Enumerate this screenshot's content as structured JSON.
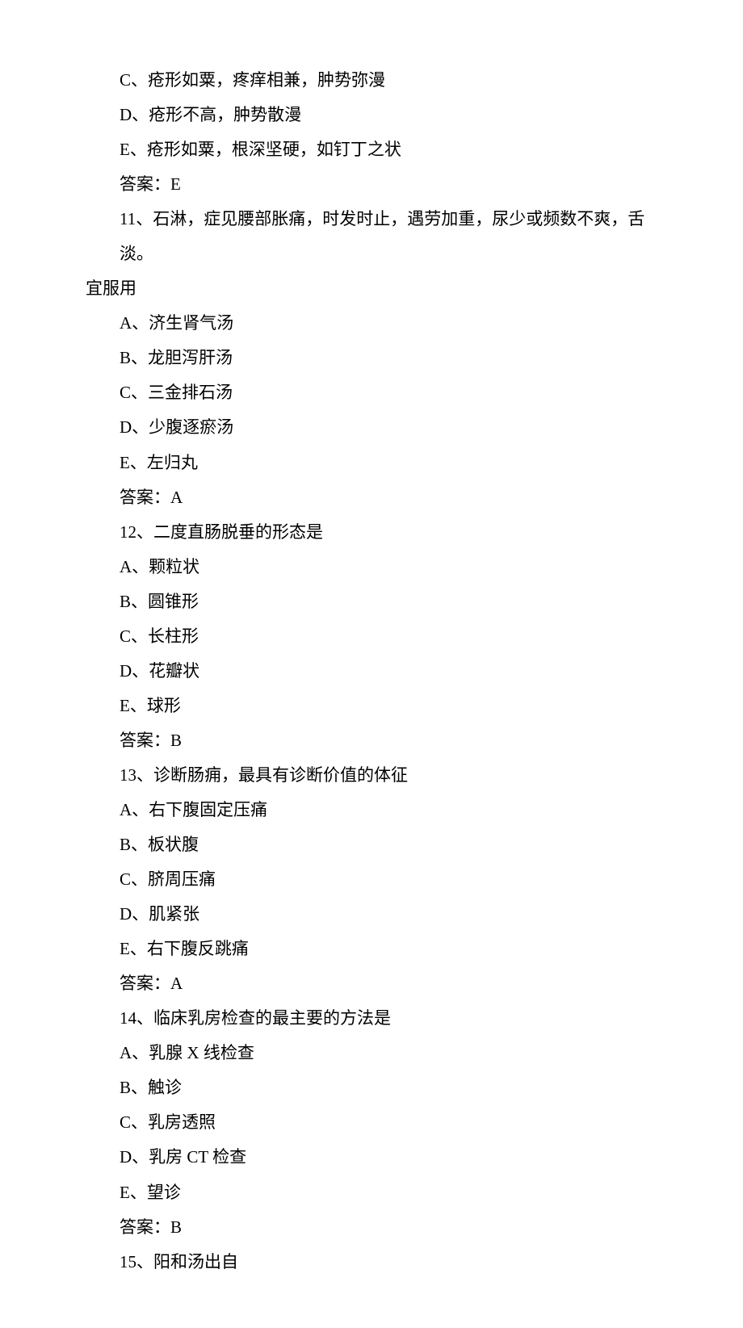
{
  "lines": [
    {
      "indent": 2,
      "text": "C、疮形如粟，疼痒相兼，肿势弥漫"
    },
    {
      "indent": 2,
      "text": "D、疮形不高，肿势散漫"
    },
    {
      "indent": 2,
      "text": "E、疮形如粟，根深坚硬，如钉丁之状"
    },
    {
      "indent": 2,
      "text": "答案：E"
    },
    {
      "indent": 2,
      "text": "11、石淋，症见腰部胀痛，时发时止，遇劳加重，尿少或频数不爽，舌淡。"
    },
    {
      "indent": 0,
      "text": "宜服用"
    },
    {
      "indent": 2,
      "text": "A、济生肾气汤"
    },
    {
      "indent": 2,
      "text": "B、龙胆泻肝汤"
    },
    {
      "indent": 2,
      "text": "C、三金排石汤"
    },
    {
      "indent": 2,
      "text": "D、少腹逐瘀汤"
    },
    {
      "indent": 2,
      "text": "E、左归丸"
    },
    {
      "indent": 2,
      "text": "答案：A"
    },
    {
      "indent": 2,
      "text": "12、二度直肠脱垂的形态是"
    },
    {
      "indent": 2,
      "text": "A、颗粒状"
    },
    {
      "indent": 2,
      "text": "B、圆锥形"
    },
    {
      "indent": 2,
      "text": "C、长柱形"
    },
    {
      "indent": 2,
      "text": "D、花瓣状"
    },
    {
      "indent": 2,
      "text": "E、球形"
    },
    {
      "indent": 2,
      "text": "答案：B"
    },
    {
      "indent": 2,
      "text": "13、诊断肠痈，最具有诊断价值的体征"
    },
    {
      "indent": 2,
      "text": "A、右下腹固定压痛"
    },
    {
      "indent": 2,
      "text": "B、板状腹"
    },
    {
      "indent": 2,
      "text": "C、脐周压痛"
    },
    {
      "indent": 2,
      "text": "D、肌紧张"
    },
    {
      "indent": 2,
      "text": "E、右下腹反跳痛"
    },
    {
      "indent": 2,
      "text": "答案：A"
    },
    {
      "indent": 2,
      "text": "14、临床乳房检查的最主要的方法是"
    },
    {
      "indent": 2,
      "text": "A、乳腺 X 线检查"
    },
    {
      "indent": 2,
      "text": "B、触诊"
    },
    {
      "indent": 2,
      "text": "C、乳房透照"
    },
    {
      "indent": 2,
      "text": "D、乳房 CT 检查"
    },
    {
      "indent": 2,
      "text": "E、望诊"
    },
    {
      "indent": 2,
      "text": "答案：B"
    },
    {
      "indent": 2,
      "text": "15、阳和汤出自"
    }
  ]
}
